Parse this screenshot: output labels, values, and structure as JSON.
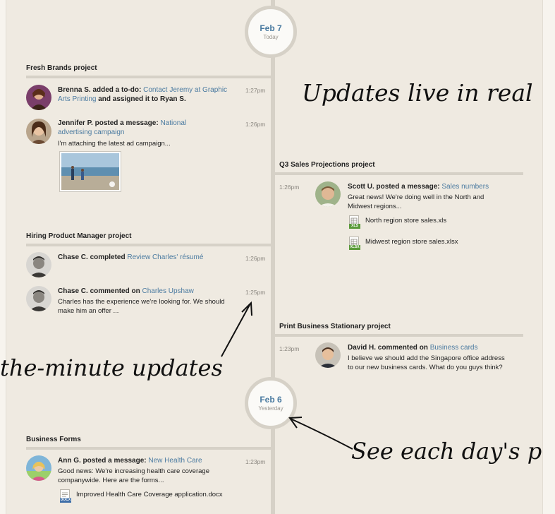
{
  "days": [
    {
      "date": "Feb 7",
      "label": "Today"
    },
    {
      "date": "Feb 6",
      "label": "Yesterday"
    }
  ],
  "projects": {
    "fresh_brands": "Fresh Brands project",
    "hiring": "Hiring Product Manager project",
    "business_forms": "Business Forms",
    "q3_sales": "Q3 Sales Projections project",
    "print_business": "Print Business Stationary project"
  },
  "items": {
    "brenna": {
      "who": "Brenna S. added a to-do:",
      "link": "Contact Jeremy at Graphic Arts Printing",
      "tail": "and assigned it to Ryan S.",
      "time": "1:27pm"
    },
    "jennifer": {
      "who": "Jennifer P. posted a message:",
      "link": "National advertising campaign",
      "body": "I'm attaching the latest ad campaign...",
      "time": "1:26pm"
    },
    "chase1": {
      "who": "Chase C. completed",
      "link": "Review Charles' résumé",
      "time": "1:26pm"
    },
    "chase2": {
      "who": "Chase C. commented on",
      "link": "Charles Upshaw",
      "body": "Charles has the experience we're looking for. We should make him an offer ...",
      "time": "1:25pm"
    },
    "ann": {
      "who": "Ann G. posted a message:",
      "link": "New Health Care",
      "body": "Good news: We're increasing health care coverage companywide. Here are the forms...",
      "time": "1:23pm",
      "attachment": "Improved Health Care Coverage application.docx",
      "attachment_tag": "DOCX"
    },
    "scott": {
      "who": "Scott U. posted a message:",
      "link": "Sales numbers",
      "body": "Great news! We're doing well in the North and Midwest regions...",
      "time": "1:26pm",
      "attachments": [
        {
          "name": "North region store sales.xls",
          "tag": "XLS"
        },
        {
          "name": "Midwest region store sales.xlsx",
          "tag": "XLSX"
        }
      ]
    },
    "david": {
      "who": "David H. commented on",
      "link": "Business cards",
      "body": "I believe we should add the Singapore office address to our new business cards. What do you guys think?",
      "time": "1:23pm"
    }
  },
  "handwriting": {
    "right_top": "Updates live in real",
    "left_mid": "the-minute updates",
    "right_bottom": "See each day's p"
  },
  "colors": {
    "link": "#4a7aa0",
    "timeline": "#d6d1c7",
    "background": "#efeae1",
    "xls_tag": "#5a9a3a",
    "docx_tag": "#3f6fa8"
  }
}
